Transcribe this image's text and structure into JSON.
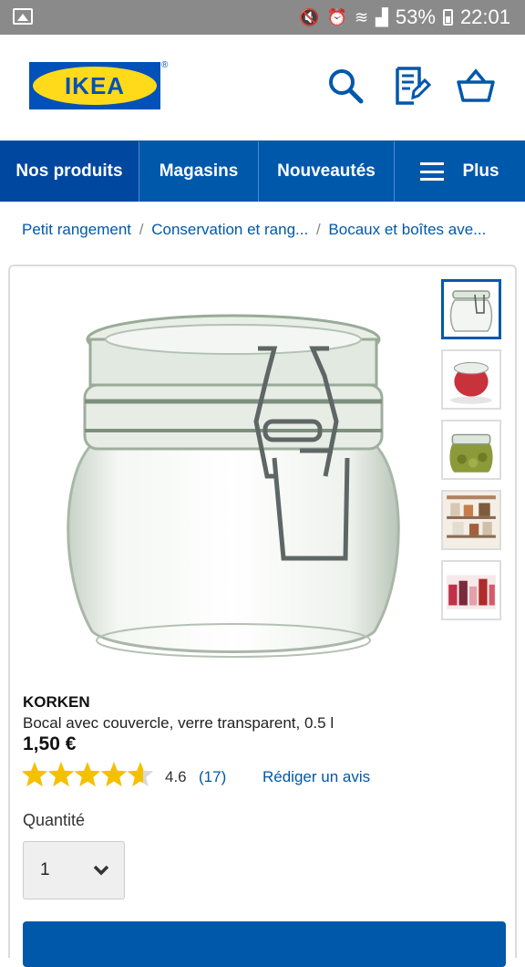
{
  "status_bar": {
    "battery": "53%",
    "time": "22:01",
    "icons": [
      "gallery-icon",
      "mute-icon",
      "alarm-icon",
      "wifi-icon",
      "signal-icon",
      "battery-icon"
    ]
  },
  "header": {
    "logo_text": "IKEA",
    "logo_registered": "®",
    "icons": [
      "search-icon",
      "shopping-list-icon",
      "basket-icon"
    ]
  },
  "nav": {
    "items": [
      {
        "label": "Nos produits",
        "active": true
      },
      {
        "label": "Magasins",
        "active": false
      },
      {
        "label": "Nouveautés",
        "active": false
      },
      {
        "label": "Plus",
        "active": false
      }
    ]
  },
  "breadcrumb": {
    "items": [
      "Petit rangement",
      "Conservation et rang...",
      "Bocaux et boîtes ave..."
    ],
    "separator": "/"
  },
  "product": {
    "name": "KORKEN",
    "description": "Bocal avec couvercle, verre transparent, 0.5 l",
    "price": "1,50 €",
    "rating": 4.6,
    "rating_text": "4.6",
    "review_count": "(17)",
    "write_review": "Rédiger un avis",
    "quantity_label": "Quantité",
    "quantity_value": "1",
    "thumbnail_count": 5
  },
  "colors": {
    "brand_blue": "#0058ab",
    "brand_yellow": "#ffda1a",
    "star": "#f5c000"
  }
}
